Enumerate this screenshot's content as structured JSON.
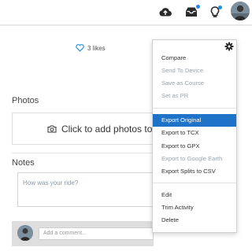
{
  "topbar": {
    "upload_icon": "cloud-upload-icon",
    "inbox_icon": "inbox-tray-icon",
    "notifications_icon": "lightbulb-icon",
    "accent": "#1a8fe3"
  },
  "activity": {
    "likes_label": "3 likes"
  },
  "photos": {
    "title": "Photos",
    "add_label": "Click to add photos to"
  },
  "notes": {
    "title": "Notes",
    "placeholder": "How was your ride?"
  },
  "comments": {
    "placeholder": "Add a comment..."
  },
  "menu": {
    "items": [
      {
        "label": "Compare",
        "enabled": true
      },
      {
        "label": "Send To Device",
        "enabled": false
      },
      {
        "label": "Save as Course",
        "enabled": false
      },
      {
        "label": "Set as PR",
        "enabled": false
      },
      {
        "label": "Export Original",
        "enabled": true,
        "highlighted": true
      },
      {
        "label": "Export to TCX",
        "enabled": true
      },
      {
        "label": "Export to GPX",
        "enabled": true
      },
      {
        "label": "Export to Google Earth",
        "enabled": false
      },
      {
        "label": "Export Splits to CSV",
        "enabled": true
      },
      {
        "label": "Edit",
        "enabled": true
      },
      {
        "label": "Trim Activity",
        "enabled": true
      },
      {
        "label": "Delete",
        "enabled": true
      }
    ],
    "highlight_color": "#1e73c8",
    "disabled_color": "#9aa4ad"
  }
}
